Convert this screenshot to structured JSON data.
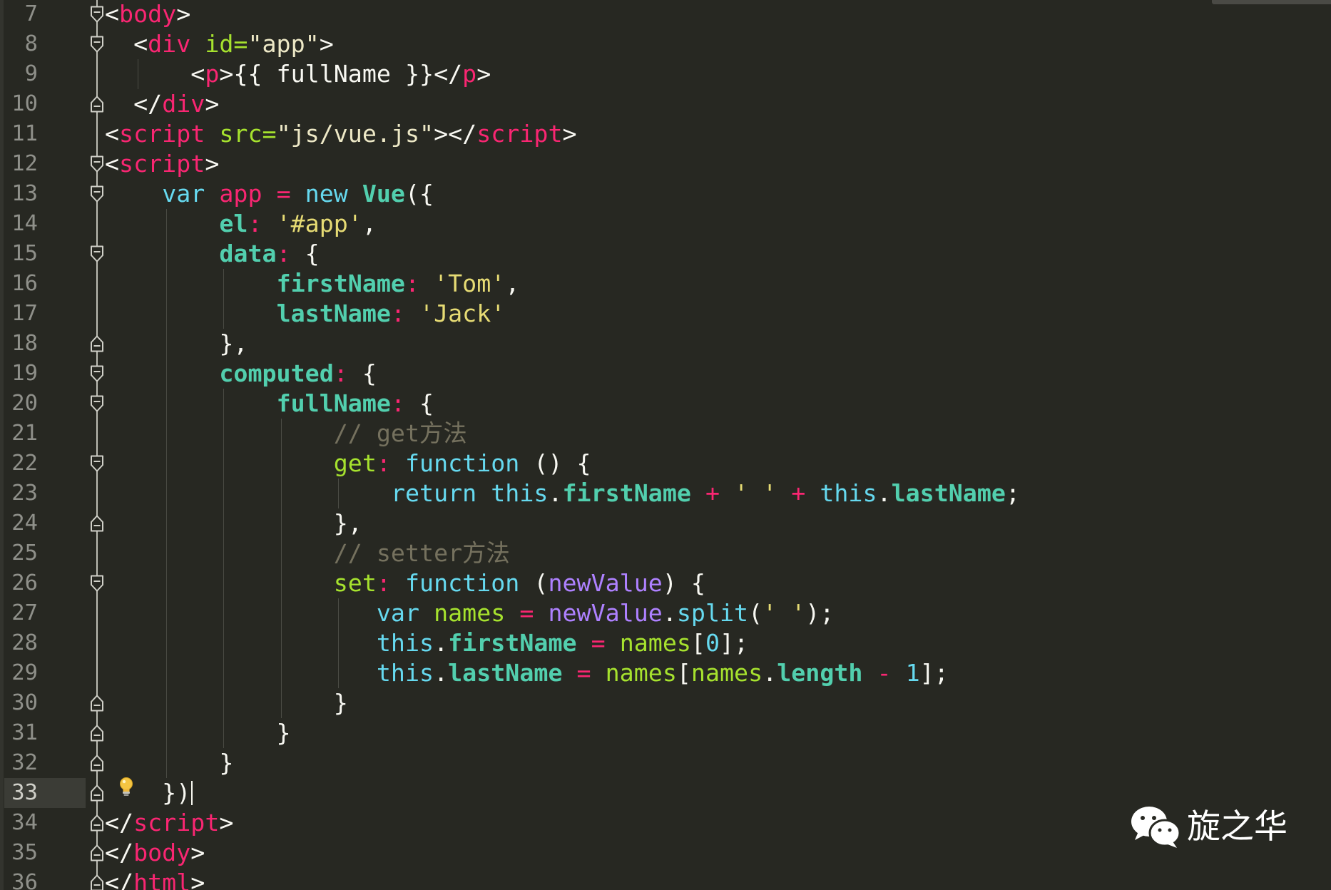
{
  "editor": {
    "background": "#272822",
    "line_number_color": "#8f908a",
    "current_line": 33,
    "cursor": {
      "line": 33,
      "column": 6
    },
    "hint_icon": {
      "line": 33,
      "icon": "lightbulb-icon"
    },
    "lines": [
      {
        "num": "7",
        "fold": "fold-open-icon",
        "tokens": [
          {
            "t": "<",
            "c": "#f8f8f2"
          },
          {
            "t": "body",
            "c": "#f92672"
          },
          {
            "t": ">",
            "c": "#f8f8f2"
          }
        ]
      },
      {
        "num": "8",
        "fold": "fold-open-icon",
        "tokens": [
          {
            "t": "  <",
            "c": "#f8f8f2"
          },
          {
            "t": "div",
            "c": "#f92672"
          },
          {
            "t": " ",
            "c": "#f8f8f2"
          },
          {
            "t": "id=",
            "c": "#a6e22e"
          },
          {
            "t": "\"app\"",
            "c": "#ede8c6"
          },
          {
            "t": ">",
            "c": "#f8f8f2"
          }
        ]
      },
      {
        "num": "9",
        "tokens": [
          {
            "t": "      <",
            "c": "#f8f8f2"
          },
          {
            "t": "p",
            "c": "#f92672"
          },
          {
            "t": ">{{ fullName }}</",
            "c": "#f8f8f2"
          },
          {
            "t": "p",
            "c": "#f92672"
          },
          {
            "t": ">",
            "c": "#f8f8f2"
          }
        ]
      },
      {
        "num": "10",
        "fold": "fold-close-icon",
        "tokens": [
          {
            "t": "  </",
            "c": "#f8f8f2"
          },
          {
            "t": "div",
            "c": "#f92672"
          },
          {
            "t": ">",
            "c": "#f8f8f2"
          }
        ]
      },
      {
        "num": "11",
        "tokens": [
          {
            "t": "<",
            "c": "#f8f8f2"
          },
          {
            "t": "script",
            "c": "#f92672"
          },
          {
            "t": " ",
            "c": "#f8f8f2"
          },
          {
            "t": "src=",
            "c": "#a6e22e"
          },
          {
            "t": "\"js/vue.js\"",
            "c": "#ede8c6"
          },
          {
            "t": "></",
            "c": "#f8f8f2"
          },
          {
            "t": "script",
            "c": "#f92672"
          },
          {
            "t": ">",
            "c": "#f8f8f2"
          }
        ]
      },
      {
        "num": "12",
        "fold": "fold-open-icon",
        "tokens": [
          {
            "t": "<",
            "c": "#f8f8f2"
          },
          {
            "t": "script",
            "c": "#f92672"
          },
          {
            "t": ">",
            "c": "#f8f8f2"
          }
        ]
      },
      {
        "num": "13",
        "fold": "fold-open-icon",
        "tokens": [
          {
            "t": "    ",
            "c": "#f8f8f2"
          },
          {
            "t": "var",
            "c": "#66d9ef"
          },
          {
            "t": " ",
            "c": "#f8f8f2"
          },
          {
            "t": "app",
            "c": "#f92672"
          },
          {
            "t": " ",
            "c": "#f8f8f2"
          },
          {
            "t": "=",
            "c": "#f92672"
          },
          {
            "t": " ",
            "c": "#f8f8f2"
          },
          {
            "t": "new",
            "c": "#66d9ef"
          },
          {
            "t": " ",
            "c": "#f8f8f2"
          },
          {
            "t": "Vue",
            "c": "#52cfae",
            "b": true
          },
          {
            "t": "({",
            "c": "#f8f8f2"
          }
        ]
      },
      {
        "num": "14",
        "tokens": [
          {
            "t": "        ",
            "c": "#f8f8f2"
          },
          {
            "t": "el",
            "c": "#52cfae",
            "b": true
          },
          {
            "t": ":",
            "c": "#f92672"
          },
          {
            "t": " ",
            "c": "#f8f8f2"
          },
          {
            "t": "'#app'",
            "c": "#e6db74"
          },
          {
            "t": ",",
            "c": "#f8f8f2"
          }
        ]
      },
      {
        "num": "15",
        "fold": "fold-open-icon",
        "tokens": [
          {
            "t": "        ",
            "c": "#f8f8f2"
          },
          {
            "t": "data",
            "c": "#52cfae",
            "b": true
          },
          {
            "t": ":",
            "c": "#f92672"
          },
          {
            "t": " {",
            "c": "#f8f8f2"
          }
        ]
      },
      {
        "num": "16",
        "tokens": [
          {
            "t": "            ",
            "c": "#f8f8f2"
          },
          {
            "t": "firstName",
            "c": "#52cfae",
            "b": true
          },
          {
            "t": ":",
            "c": "#f92672"
          },
          {
            "t": " ",
            "c": "#f8f8f2"
          },
          {
            "t": "'Tom'",
            "c": "#e6db74"
          },
          {
            "t": ",",
            "c": "#f8f8f2"
          }
        ]
      },
      {
        "num": "17",
        "tokens": [
          {
            "t": "            ",
            "c": "#f8f8f2"
          },
          {
            "t": "lastName",
            "c": "#52cfae",
            "b": true
          },
          {
            "t": ":",
            "c": "#f92672"
          },
          {
            "t": " ",
            "c": "#f8f8f2"
          },
          {
            "t": "'Jack'",
            "c": "#e6db74"
          }
        ]
      },
      {
        "num": "18",
        "fold": "fold-close-icon",
        "tokens": [
          {
            "t": "        },",
            "c": "#f8f8f2"
          }
        ]
      },
      {
        "num": "19",
        "fold": "fold-open-icon",
        "tokens": [
          {
            "t": "        ",
            "c": "#f8f8f2"
          },
          {
            "t": "computed",
            "c": "#52cfae",
            "b": true
          },
          {
            "t": ":",
            "c": "#f92672"
          },
          {
            "t": " {",
            "c": "#f8f8f2"
          }
        ]
      },
      {
        "num": "20",
        "fold": "fold-open-icon",
        "tokens": [
          {
            "t": "            ",
            "c": "#f8f8f2"
          },
          {
            "t": "fullName",
            "c": "#52cfae",
            "b": true
          },
          {
            "t": ":",
            "c": "#f92672"
          },
          {
            "t": " {",
            "c": "#f8f8f2"
          }
        ]
      },
      {
        "num": "21",
        "tokens": [
          {
            "t": "                ",
            "c": "#f8f8f2"
          },
          {
            "t": "// get方法",
            "c": "#75715e"
          }
        ]
      },
      {
        "num": "22",
        "fold": "fold-open-icon",
        "tokens": [
          {
            "t": "                ",
            "c": "#f8f8f2"
          },
          {
            "t": "get",
            "c": "#a6e22e"
          },
          {
            "t": ":",
            "c": "#f92672"
          },
          {
            "t": " ",
            "c": "#f8f8f2"
          },
          {
            "t": "function",
            "c": "#66d9ef"
          },
          {
            "t": " () {",
            "c": "#f8f8f2"
          }
        ]
      },
      {
        "num": "23",
        "tokens": [
          {
            "t": "                    ",
            "c": "#f8f8f2"
          },
          {
            "t": "return",
            "c": "#66d9ef"
          },
          {
            "t": " ",
            "c": "#f8f8f2"
          },
          {
            "t": "this",
            "c": "#66d9ef"
          },
          {
            "t": ".",
            "c": "#f8f8f2"
          },
          {
            "t": "firstName",
            "c": "#52cfae",
            "b": true
          },
          {
            "t": " ",
            "c": "#f8f8f2"
          },
          {
            "t": "+",
            "c": "#f92672"
          },
          {
            "t": " ",
            "c": "#f8f8f2"
          },
          {
            "t": "' '",
            "c": "#e6db74"
          },
          {
            "t": " ",
            "c": "#f8f8f2"
          },
          {
            "t": "+",
            "c": "#f92672"
          },
          {
            "t": " ",
            "c": "#f8f8f2"
          },
          {
            "t": "this",
            "c": "#66d9ef"
          },
          {
            "t": ".",
            "c": "#f8f8f2"
          },
          {
            "t": "lastName",
            "c": "#52cfae",
            "b": true
          },
          {
            "t": ";",
            "c": "#f8f8f2"
          }
        ]
      },
      {
        "num": "24",
        "fold": "fold-close-icon",
        "tokens": [
          {
            "t": "                },",
            "c": "#f8f8f2"
          }
        ]
      },
      {
        "num": "25",
        "tokens": [
          {
            "t": "                ",
            "c": "#f8f8f2"
          },
          {
            "t": "// setter方法",
            "c": "#75715e"
          }
        ]
      },
      {
        "num": "26",
        "fold": "fold-open-icon",
        "tokens": [
          {
            "t": "                ",
            "c": "#f8f8f2"
          },
          {
            "t": "set",
            "c": "#a6e22e"
          },
          {
            "t": ":",
            "c": "#f92672"
          },
          {
            "t": " ",
            "c": "#f8f8f2"
          },
          {
            "t": "function",
            "c": "#66d9ef"
          },
          {
            "t": " (",
            "c": "#f8f8f2"
          },
          {
            "t": "newValue",
            "c": "#ae81ff"
          },
          {
            "t": ") {",
            "c": "#f8f8f2"
          }
        ]
      },
      {
        "num": "27",
        "tokens": [
          {
            "t": "                   ",
            "c": "#f8f8f2"
          },
          {
            "t": "var",
            "c": "#66d9ef"
          },
          {
            "t": " ",
            "c": "#f8f8f2"
          },
          {
            "t": "names",
            "c": "#a6e22e"
          },
          {
            "t": " ",
            "c": "#f8f8f2"
          },
          {
            "t": "=",
            "c": "#f92672"
          },
          {
            "t": " ",
            "c": "#f8f8f2"
          },
          {
            "t": "newValue",
            "c": "#ae81ff"
          },
          {
            "t": ".",
            "c": "#f8f8f2"
          },
          {
            "t": "split",
            "c": "#66d9ef"
          },
          {
            "t": "(",
            "c": "#f8f8f2"
          },
          {
            "t": "' '",
            "c": "#e6db74"
          },
          {
            "t": ");",
            "c": "#f8f8f2"
          }
        ]
      },
      {
        "num": "28",
        "tokens": [
          {
            "t": "                   ",
            "c": "#f8f8f2"
          },
          {
            "t": "this",
            "c": "#66d9ef"
          },
          {
            "t": ".",
            "c": "#f8f8f2"
          },
          {
            "t": "firstName",
            "c": "#52cfae",
            "b": true
          },
          {
            "t": " ",
            "c": "#f8f8f2"
          },
          {
            "t": "=",
            "c": "#f92672"
          },
          {
            "t": " ",
            "c": "#f8f8f2"
          },
          {
            "t": "names",
            "c": "#a6e22e"
          },
          {
            "t": "[",
            "c": "#f8f8f2"
          },
          {
            "t": "0",
            "c": "#66d9ef"
          },
          {
            "t": "];",
            "c": "#f8f8f2"
          }
        ]
      },
      {
        "num": "29",
        "tokens": [
          {
            "t": "                   ",
            "c": "#f8f8f2"
          },
          {
            "t": "this",
            "c": "#66d9ef"
          },
          {
            "t": ".",
            "c": "#f8f8f2"
          },
          {
            "t": "lastName",
            "c": "#52cfae",
            "b": true
          },
          {
            "t": " ",
            "c": "#f8f8f2"
          },
          {
            "t": "=",
            "c": "#f92672"
          },
          {
            "t": " ",
            "c": "#f8f8f2"
          },
          {
            "t": "names",
            "c": "#a6e22e"
          },
          {
            "t": "[",
            "c": "#f8f8f2"
          },
          {
            "t": "names",
            "c": "#a6e22e"
          },
          {
            "t": ".",
            "c": "#f8f8f2"
          },
          {
            "t": "length",
            "c": "#52cfae",
            "b": true
          },
          {
            "t": " ",
            "c": "#f8f8f2"
          },
          {
            "t": "-",
            "c": "#f92672"
          },
          {
            "t": " ",
            "c": "#f8f8f2"
          },
          {
            "t": "1",
            "c": "#66d9ef"
          },
          {
            "t": "];",
            "c": "#f8f8f2"
          }
        ]
      },
      {
        "num": "30",
        "fold": "fold-close-icon",
        "tokens": [
          {
            "t": "                }",
            "c": "#f8f8f2"
          }
        ]
      },
      {
        "num": "31",
        "fold": "fold-close-icon",
        "tokens": [
          {
            "t": "            }",
            "c": "#f8f8f2"
          }
        ]
      },
      {
        "num": "32",
        "fold": "fold-close-icon",
        "tokens": [
          {
            "t": "        }",
            "c": "#f8f8f2"
          }
        ]
      },
      {
        "num": "33",
        "fold": "fold-close-icon",
        "tokens": [
          {
            "t": "    })",
            "c": "#f8f8f2"
          }
        ]
      },
      {
        "num": "34",
        "fold": "fold-close-icon",
        "tokens": [
          {
            "t": "</",
            "c": "#f8f8f2"
          },
          {
            "t": "script",
            "c": "#f92672"
          },
          {
            "t": ">",
            "c": "#f8f8f2"
          }
        ]
      },
      {
        "num": "35",
        "fold": "fold-close-icon",
        "tokens": [
          {
            "t": "</",
            "c": "#f8f8f2"
          },
          {
            "t": "body",
            "c": "#f92672"
          },
          {
            "t": ">",
            "c": "#f8f8f2"
          }
        ]
      },
      {
        "num": "36",
        "fold": "fold-close-icon",
        "tokens": [
          {
            "t": "</",
            "c": "#f8f8f2"
          },
          {
            "t": "html",
            "c": "#f92672"
          },
          {
            "t": ">",
            "c": "#f8f8f2"
          }
        ]
      }
    ]
  },
  "watermark": {
    "icon": "wechat-icon",
    "text": "旋之华"
  }
}
